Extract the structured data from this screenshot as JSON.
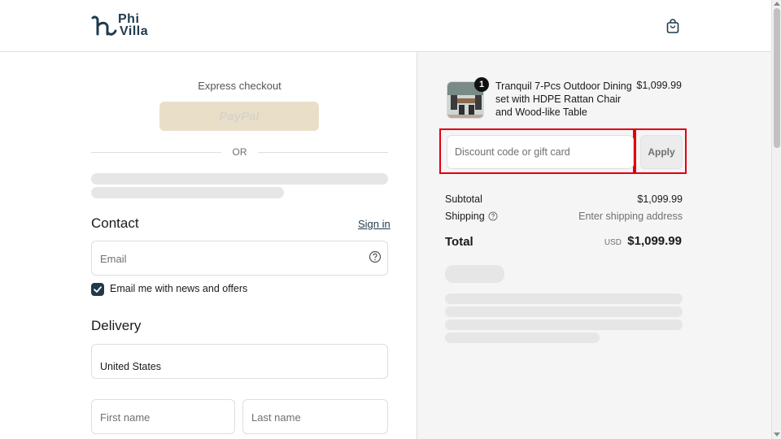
{
  "brand": {
    "line1": "Phi",
    "line2": "Villa",
    "color": "#1f3a4b"
  },
  "header": {
    "cart_icon": "shopping-bag-icon"
  },
  "express": {
    "label": "Express checkout",
    "paypal_label": "PayPal",
    "or_label": "OR"
  },
  "contact": {
    "title": "Contact",
    "signin_label": "Sign in",
    "email_placeholder": "Email",
    "newsletter_label": "Email me with news and offers",
    "newsletter_checked": true
  },
  "delivery": {
    "title": "Delivery",
    "country_value": "United States",
    "first_name_placeholder": "First name",
    "last_name_placeholder": "Last name"
  },
  "order": {
    "item": {
      "title": "Tranquil 7-Pcs Outdoor Dining set with HDPE Rattan Chair and Wood-like Table",
      "price": "$1,099.99",
      "quantity": "1"
    },
    "discount_placeholder": "Discount code or gift card",
    "apply_label": "Apply",
    "subtotal_label": "Subtotal",
    "subtotal_value": "$1,099.99",
    "shipping_label": "Shipping",
    "shipping_value": "Enter shipping address",
    "total_label": "Total",
    "currency": "USD",
    "total_value": "$1,099.99"
  },
  "colors": {
    "accent": "#1f3a4b",
    "highlight": "#e0000f",
    "paypal_bg": "#e9dfc9"
  }
}
